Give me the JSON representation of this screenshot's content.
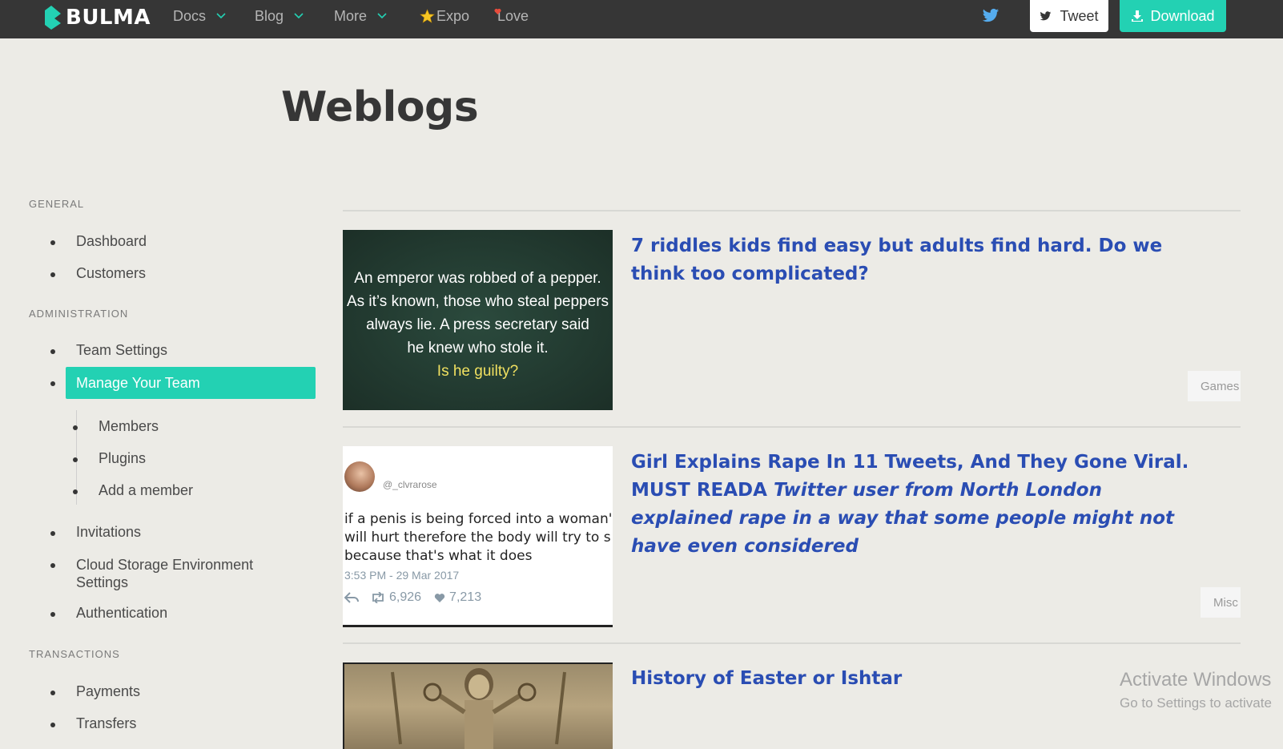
{
  "navbar": {
    "brand": "BULMA",
    "items": [
      {
        "label": "Docs",
        "has_dropdown": true
      },
      {
        "label": "Blog",
        "has_dropdown": true
      },
      {
        "label": "More",
        "has_dropdown": true
      },
      {
        "label": "Expo",
        "icon": "star-icon"
      },
      {
        "label": "Love",
        "icon": "heart-icon"
      }
    ],
    "tweet_label": "Tweet",
    "download_label": "Download",
    "colors": {
      "bar": "#363636",
      "accent": "#23d1b3",
      "twitter": "#55acee"
    }
  },
  "page": {
    "title": "Weblogs"
  },
  "sidebar": {
    "general_label": "General",
    "general_items": [
      "Dashboard",
      "Customers"
    ],
    "admin_label": "Administration",
    "admin_items": [
      "Team Settings",
      "Manage Your Team"
    ],
    "active_item": "Manage Your Team",
    "team_subitems": [
      "Members",
      "Plugins",
      "Add a member"
    ],
    "admin_items_after": [
      "Invitations",
      "Cloud Storage Environment Settings",
      "Authentication"
    ],
    "transactions_label": "Transactions",
    "transactions_items": [
      "Payments",
      "Transfers"
    ]
  },
  "posts": [
    {
      "title": "7 riddles kids find easy but adults find hard. Do we think too complicated?",
      "tag": "Games",
      "thumb_lines": [
        "An emperor was robbed of a pepper.",
        "As it’s known, those who steal peppers",
        "always lie. A press secretary said",
        "he knew who stole it."
      ],
      "thumb_question": "Is he guilty?"
    },
    {
      "title_plain": "Girl Explains Rape In 11 Tweets, And They Gone Viral. MUST READA",
      "title_italic": "Twitter user from North London explained rape in a way that some people might not have even considered",
      "tag": "Misc",
      "thumb_handle": "@_clvrarose",
      "thumb_lines": [
        "if a penis is being forced into a woman'",
        "will hurt therefore the body will try to s",
        "because that's what it does"
      ],
      "thumb_time": "3:53 PM - 29 Mar 2017",
      "thumb_retweets": "6,926",
      "thumb_likes": "7,213"
    },
    {
      "title": "History of Easter or Ishtar"
    }
  ],
  "watermark": {
    "line1": "Activate Windows",
    "line2": "Go to Settings to activate"
  }
}
